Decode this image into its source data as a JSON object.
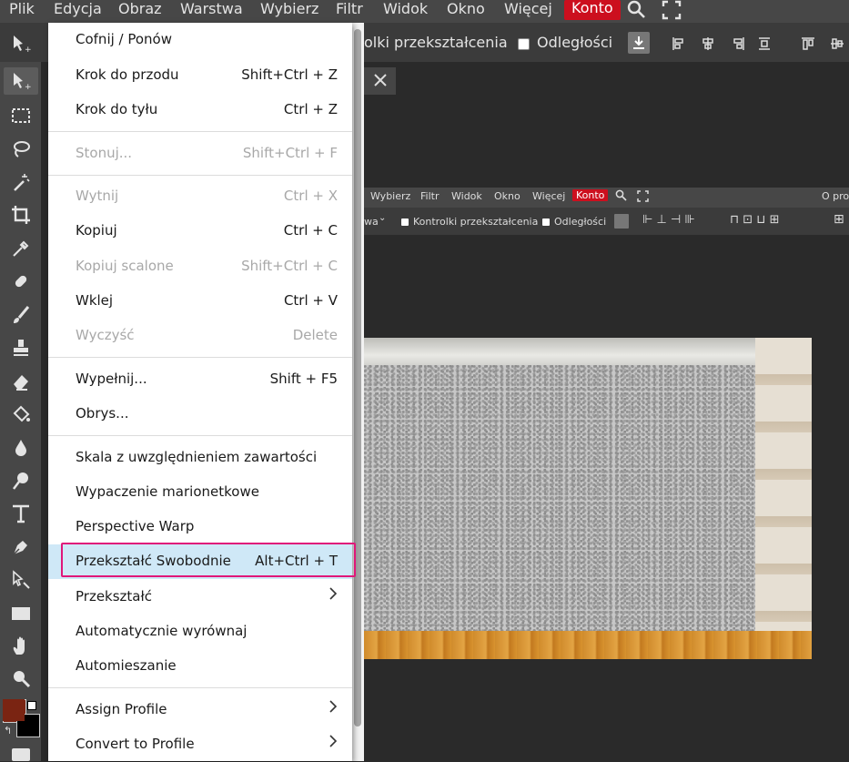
{
  "menubar": {
    "items": [
      "Plik",
      "Edycja",
      "Obraz",
      "Warstwa",
      "Wybierz",
      "Filtr",
      "Widok",
      "Okno",
      "Więcej"
    ],
    "account": "Konto"
  },
  "options": {
    "transform_controls": "olki przekształcenia",
    "distances": "Odległości"
  },
  "inner": {
    "menu_items": [
      "Wybierz",
      "Filtr",
      "Widok",
      "Okno",
      "Więcej"
    ],
    "account": "Konto",
    "right_text": "O pro",
    "option_fragment": "wa",
    "transform_controls": "Kontrolki przekształcenia",
    "distances": "Odległości"
  },
  "menu": {
    "items": [
      {
        "label": "Cofnij / Ponów",
        "shortcut": ""
      },
      {
        "label": "Krok do przodu",
        "shortcut": "Shift+Ctrl + Z"
      },
      {
        "label": "Krok do tyłu",
        "shortcut": "Ctrl + Z"
      },
      {
        "label": "Stonuj...",
        "shortcut": "Shift+Ctrl + F"
      },
      {
        "label": "Wytnij",
        "shortcut": "Ctrl + X"
      },
      {
        "label": "Kopiuj",
        "shortcut": "Ctrl + C"
      },
      {
        "label": "Kopiuj scalone",
        "shortcut": "Shift+Ctrl + C"
      },
      {
        "label": "Wklej",
        "shortcut": "Ctrl + V"
      },
      {
        "label": "Wyczyść",
        "shortcut": "Delete"
      },
      {
        "label": "Wypełnij...",
        "shortcut": "Shift + F5"
      },
      {
        "label": "Obrys...",
        "shortcut": ""
      },
      {
        "label": "Skala z uwzględnieniem zawartości",
        "shortcut": ""
      },
      {
        "label": "Wypaczenie marionetkowe",
        "shortcut": ""
      },
      {
        "label": "Perspective Warp",
        "shortcut": ""
      },
      {
        "label": "Przekształć Swobodnie",
        "shortcut": "Alt+Ctrl + T"
      },
      {
        "label": "Przekształć",
        "shortcut": ""
      },
      {
        "label": "Automatycznie wyrównaj",
        "shortcut": ""
      },
      {
        "label": "Automieszanie",
        "shortcut": ""
      },
      {
        "label": "Assign Profile",
        "shortcut": ""
      },
      {
        "label": "Convert to Profile",
        "shortcut": ""
      }
    ]
  },
  "colors": {
    "accent": "#cc0f1e",
    "highlight_border": "#e0177a",
    "selected_row": "#cfe8f7",
    "foreground_color": "#7a2412",
    "background_color": "#000000"
  }
}
